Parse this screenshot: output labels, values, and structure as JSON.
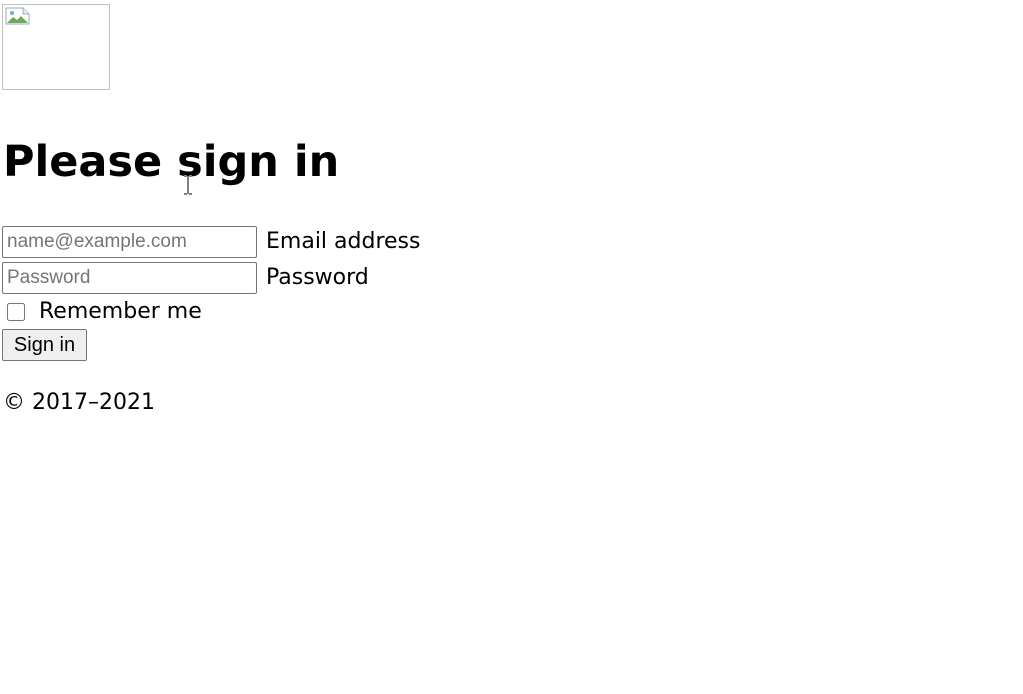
{
  "logo": {
    "icon": "broken-image-icon"
  },
  "form": {
    "heading": "Please sign in",
    "email": {
      "placeholder": "name@example.com",
      "value": "",
      "label": "Email address"
    },
    "password": {
      "placeholder": "Password",
      "value": "",
      "label": "Password"
    },
    "remember": {
      "label": "Remember me",
      "checked": false
    },
    "submit_label": "Sign in"
  },
  "footer": {
    "copyright": "© 2017–2021"
  },
  "cursor": {
    "icon": "text-cursor-icon"
  }
}
